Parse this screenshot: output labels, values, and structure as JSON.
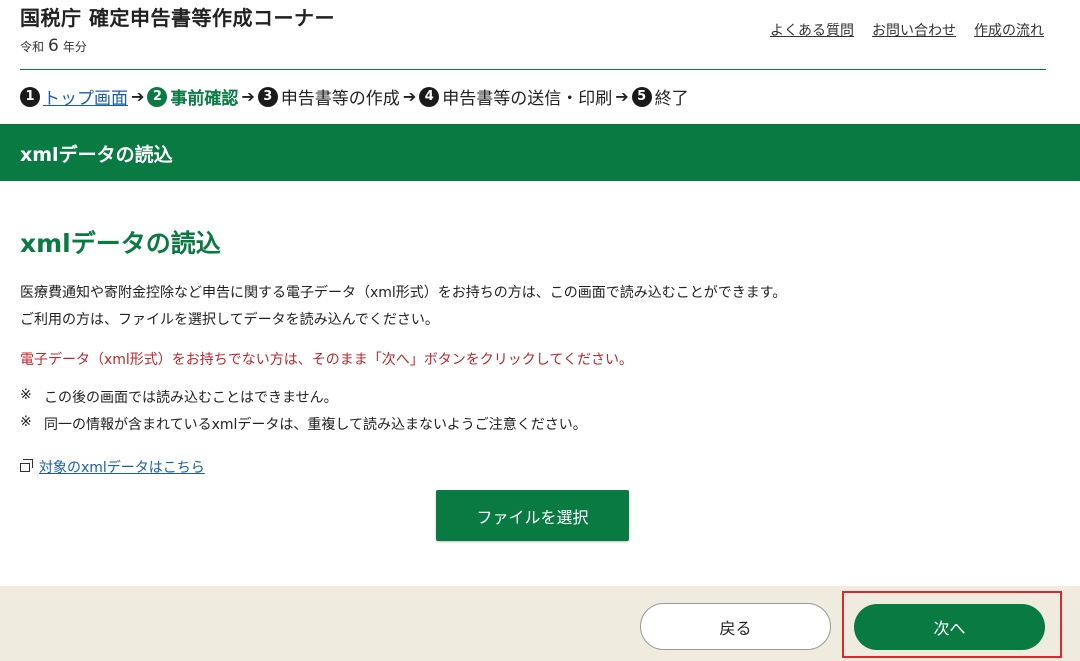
{
  "header": {
    "title": "国税庁 確定申告書等作成コーナー",
    "era_prefix": "令和",
    "era_number": "6",
    "era_suffix": "年分",
    "links": [
      "よくある質問",
      "お問い合わせ",
      "作成の流れ"
    ]
  },
  "steps": [
    {
      "num": "1",
      "label": "トップ画面",
      "state": "link"
    },
    {
      "num": "2",
      "label": "事前確認",
      "state": "current"
    },
    {
      "num": "3",
      "label": "申告書等の作成",
      "state": "plain"
    },
    {
      "num": "4",
      "label": "申告書等の送信・印刷",
      "state": "plain"
    },
    {
      "num": "5",
      "label": "終了",
      "state": "plain"
    }
  ],
  "banner": {
    "title": "xmlデータの読込"
  },
  "main": {
    "title": "xmlデータの読込",
    "intro_line1": "医療費通知や寄附金控除など申告に関する電子データ（xml形式）をお持ちの方は、この画面で読み込むことができます。",
    "intro_line2": "ご利用の方は、ファイルを選択してデータを読み込んでください。",
    "red_notice": "電子データ（xml形式）をお持ちでない方は、そのまま「次へ」ボタンをクリックしてください。",
    "note_mark": "※",
    "note1": "この後の画面では読み込むことはできません。",
    "note2": "同一の情報が含まれているxmlデータは、重複して読み込まないようご注意ください。",
    "link_text": "対象のxmlデータはこちら",
    "file_button": "ファイルを選択"
  },
  "footer": {
    "back_label": "戻る",
    "next_label": "次へ"
  },
  "colors": {
    "brand_green": "#0a7a43",
    "notice_red": "#c0262d",
    "footer_bg": "#f0ebdf",
    "highlight_red": "#e0252b"
  }
}
